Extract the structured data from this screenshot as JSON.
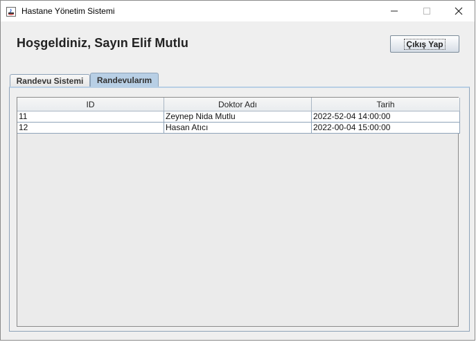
{
  "window": {
    "title": "Hastane Yönetim Sistemi",
    "icon": "java-app-icon"
  },
  "header": {
    "greeting": "Hoşgeldiniz, Sayın Elif Mutlu",
    "logout_label": "Çıkış Yap"
  },
  "tabs": [
    {
      "label": "Randevu Sistemi",
      "selected": false
    },
    {
      "label": "Randevularım",
      "selected": true
    }
  ],
  "table": {
    "columns": [
      "ID",
      "Doktor Adı",
      "Tarih"
    ],
    "rows": [
      [
        "11",
        "Zeynep Nida Mutlu",
        "2022-52-04 14:00:00"
      ],
      [
        "12",
        "Hasan Atıcı",
        "2022-00-04 15:00:00"
      ]
    ]
  },
  "colors": {
    "selected_tab": "#b8cfe5",
    "panel_bg": "#efefef",
    "border": "#8da2b8"
  }
}
